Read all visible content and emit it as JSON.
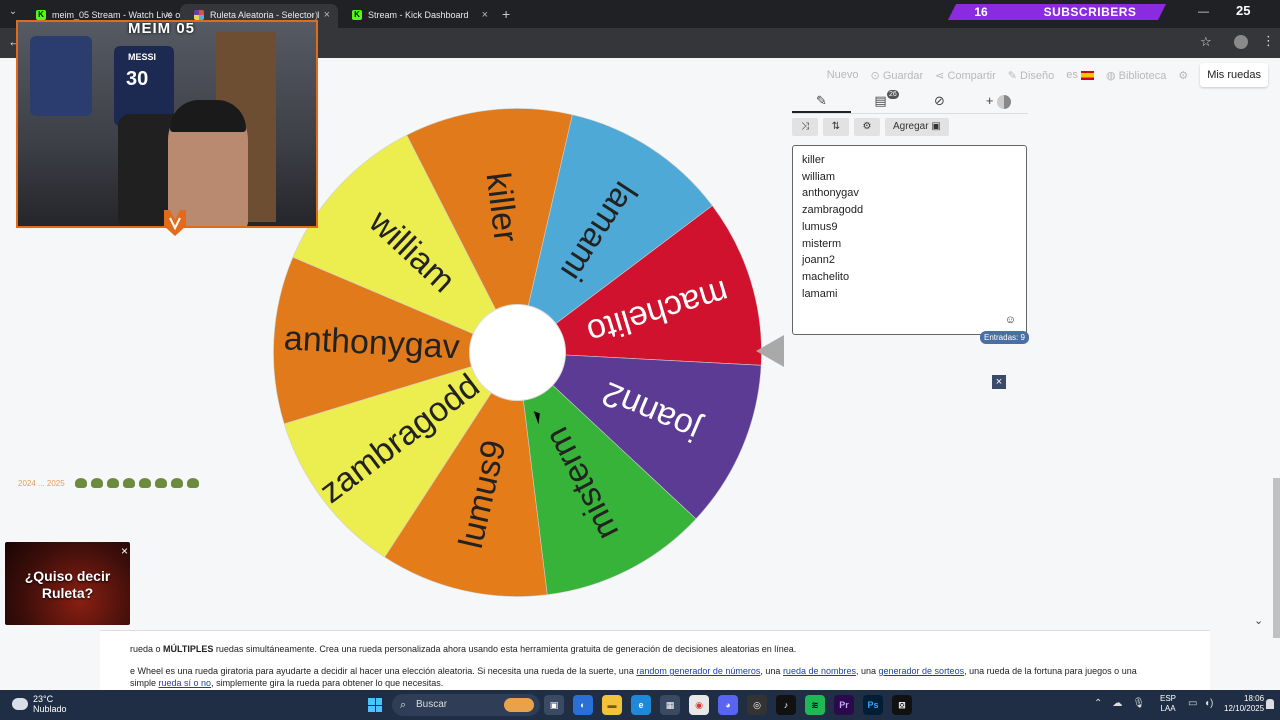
{
  "browser": {
    "tabs": [
      {
        "title": "meim_05 Stream - Watch Live o",
        "favicon": "K",
        "active": false
      },
      {
        "title": "Ruleta Aleatoria - Selector I",
        "favicon": "rueda",
        "active": true
      },
      {
        "title": "Stream - Kick Dashboard",
        "favicon": "K",
        "active": false
      }
    ],
    "new_tab": "+",
    "close_glyph": "×"
  },
  "overlay": {
    "subs_count": "16",
    "subs_label": "SUBSCRIBERS",
    "counter": "25",
    "stream_title": "MEIM 05",
    "jersey_name": "MESSI",
    "jersey_number": "30",
    "emote_label": "2024 ... 2025"
  },
  "nav": {
    "nuevo": "Nuevo",
    "guardar": "Guardar",
    "compartir": "Compartir",
    "diseno": "Diseño",
    "lang": "es",
    "biblioteca": "Biblioteca",
    "mis_ruedas": "Mis ruedas"
  },
  "panel": {
    "tab_icons": [
      "pencil-icon",
      "clipboard-icon",
      "eye-slash-icon",
      "plus-icon"
    ],
    "clipboard_badge": "26",
    "plus_label": "+",
    "agregar": "Agregar",
    "entries": [
      "killer",
      "william",
      "anthonygav",
      "zambragodd",
      "lumus9",
      "misterm",
      "joann2",
      "machelito",
      "lamami"
    ],
    "entradas": "Entradas: 9",
    "close": "×"
  },
  "wheel": {
    "segments": [
      {
        "label": "killer",
        "color": "#e07a1b"
      },
      {
        "label": "lamami",
        "color": "#4ea9d6"
      },
      {
        "label": "machelito",
        "color": "#d0122e"
      },
      {
        "label": "joann2",
        "color": "#5b3b93"
      },
      {
        "label": "misterm",
        "color": "#37b33a"
      },
      {
        "label": "lumus9",
        "color": "#e57c1a"
      },
      {
        "label": "zambragodd",
        "color": "#eced4e"
      },
      {
        "label": "anthonygav",
        "color": "#e07a1b"
      },
      {
        "label": "william",
        "color": "#eced4e"
      }
    ],
    "label_colors": {
      "killer": "#222",
      "lamami": "#222",
      "machelito": "#fff",
      "joann2": "#fff",
      "misterm": "#222",
      "lumus9": "#222",
      "zambragodd": "#222",
      "anthonygav": "#222",
      "william": "#222"
    },
    "center_color": "#ffffff",
    "pointer_color": "#a9a9a9"
  },
  "ad": {
    "text": "¿Quiso decir Ruleta?",
    "close": "×"
  },
  "article": {
    "line1_a": "rueda o ",
    "line1_b": "MÚLTIPLES",
    "line1_c": " ruedas simultáneamente. Crea una rueda personalizada ahora usando esta herramienta gratuita de generación de decisiones aleatorias en línea.",
    "line2_a": "e Wheel es una rueda giratoria para ayudarte a decidir al hacer una elección aleatoria. Si necesita una rueda de la suerte, una ",
    "link1": "random generador de números",
    "line2_b": ", una ",
    "link2": "rueda de nombres",
    "line2_c": ", una ",
    "link3": "generador de sorteos",
    "line2_d": ", una rueda de la fortuna para juegos o una",
    "line3_a": "simple ",
    "link4": "rueda sí o no",
    "line3_b": ", simplemente gira la rueda para obtener lo que necesitas."
  },
  "taskbar": {
    "temp": "23°C",
    "weather": "Nublado",
    "search": "Buscar",
    "lang1": "ESP",
    "lang2": "LAA",
    "time": "18:06",
    "date": "12/10/2025",
    "apps": [
      {
        "name": "task-view",
        "label": "▣",
        "bg": "#3a4a62",
        "fg": "#fff"
      },
      {
        "name": "copilot",
        "label": "◐",
        "bg": "#2a6fd6",
        "fg": "#fff"
      },
      {
        "name": "explorer",
        "label": "▬",
        "bg": "#f2c23a",
        "fg": "#7a5a00"
      },
      {
        "name": "edge",
        "label": "e",
        "bg": "#1e88d9",
        "fg": "#fff"
      },
      {
        "name": "store",
        "label": "▦",
        "bg": "#3a4a62",
        "fg": "#fff"
      },
      {
        "name": "chrome",
        "label": "◉",
        "bg": "#e8e8e8",
        "fg": "#d33"
      },
      {
        "name": "discord",
        "label": "◕",
        "bg": "#5865f2",
        "fg": "#fff"
      },
      {
        "name": "obs",
        "label": "◎",
        "bg": "#333",
        "fg": "#fff"
      },
      {
        "name": "capcut",
        "label": "♪",
        "bg": "#111",
        "fg": "#fff"
      },
      {
        "name": "spotify",
        "label": "≋",
        "bg": "#1db954",
        "fg": "#000"
      },
      {
        "name": "premiere",
        "label": "Pr",
        "bg": "#2a0a4a",
        "fg": "#c9a7ff"
      },
      {
        "name": "photoshop",
        "label": "Ps",
        "bg": "#001e36",
        "fg": "#31a8ff"
      },
      {
        "name": "capcut-editor",
        "label": "⊠",
        "bg": "#111",
        "fg": "#fff"
      }
    ]
  }
}
